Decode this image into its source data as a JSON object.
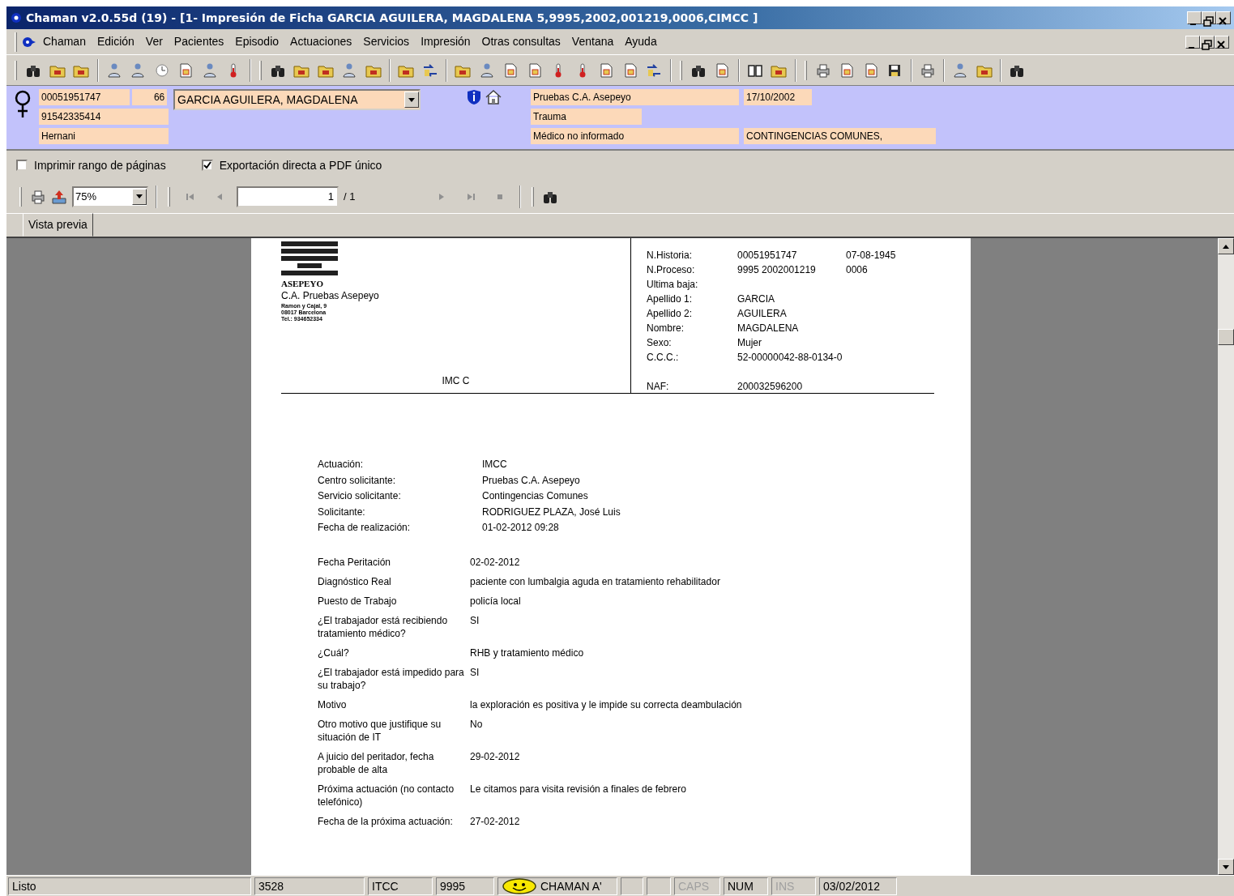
{
  "window": {
    "title": "Chaman v2.0.55d (19) - [1- Impresión de Ficha GARCIA AGUILERA, MAGDALENA 5,9995,2002,001219,0006,CIMCC  ]"
  },
  "menu": [
    "Chaman",
    "Edición",
    "Ver",
    "Pacientes",
    "Episodio",
    "Actuaciones",
    "Servicios",
    "Impresión",
    "Otras consultas",
    "Ventana",
    "Ayuda"
  ],
  "patient": {
    "history": "00051951747",
    "age": "66",
    "phone": "91542335414",
    "city": "Hernani",
    "name": "GARCIA AGUILERA, MAGDALENA",
    "center": "Pruebas C.A. Asepeyo",
    "date": "17/10/2002",
    "service": "Trauma",
    "doctor": "Médico no informado",
    "contingency": "CONTINGENCIAS COMUNES,"
  },
  "options": [
    {
      "label": "Imprimir rango de páginas",
      "checked": false
    },
    {
      "label": "Exportación directa a PDF único",
      "checked": true
    }
  ],
  "preview_toolbar": {
    "zoom": "75%",
    "page": "1",
    "page_total": "/ 1"
  },
  "tabs": [
    {
      "label": "Vista previa",
      "selected": true
    }
  ],
  "report": {
    "logo_text": "ASEPEYO",
    "center": "C.A. Pruebas Asepeyo",
    "address_lines": [
      "Ramon y Cajal, 9",
      "08017 Barcelona",
      "Tel.: 934652334"
    ],
    "code": "IMC C",
    "header_fields": [
      {
        "label": "N.Historia:",
        "value": "00051951747",
        "extra": "07-08-1945"
      },
      {
        "label": "N.Proceso:",
        "value": "9995 2002001219",
        "extra": "0006"
      },
      {
        "label": "Ultima baja:"
      },
      {
        "label": "Apellido 1:",
        "value": "GARCIA"
      },
      {
        "label": "Apellido 2:",
        "value": "AGUILERA"
      },
      {
        "label": "Nombre:",
        "value": "MAGDALENA"
      },
      {
        "label": "Sexo:",
        "value": "Mujer"
      },
      {
        "label": "C.C.C.:",
        "value": "52-00000042-88-0134-0"
      },
      {
        "label": "NAF:",
        "value": "200032596200"
      }
    ],
    "sections": [
      [
        {
          "label": "Actuación:",
          "value": "IMCC"
        },
        {
          "label": "Centro solicitante:",
          "value": "Pruebas C.A. Asepeyo"
        },
        {
          "label": "Servicio solicitante:",
          "value": "Contingencias Comunes"
        },
        {
          "label": "Solicitante:",
          "value": "RODRIGUEZ PLAZA, José Luis"
        },
        {
          "label": "Fecha de realización:",
          "value": "01-02-2012    09:28"
        }
      ],
      [
        {
          "label": "Fecha Peritación",
          "value": "02-02-2012"
        },
        {
          "label": "Diagnóstico Real",
          "value": "paciente con lumbalgia aguda en tratamiento rehabilitador"
        },
        {
          "label": "Puesto de Trabajo",
          "value": "policía local"
        },
        {
          "label": "¿El trabajador está recibiendo tratamiento médico?",
          "value": "SI"
        },
        {
          "label": "¿Cuál?",
          "value": "RHB y tratamiento médico"
        },
        {
          "label": "¿El trabajador está impedido para su trabajo?",
          "value": "SI"
        },
        {
          "label": "Motivo",
          "value": "la exploración es positiva y le impide su correcta deambulación"
        },
        {
          "label": "Otro motivo que justifique su situación de IT",
          "value": "No"
        },
        {
          "label": "A juicio del peritador, fecha probable de alta",
          "value": "29-02-2012"
        },
        {
          "label": "Próxima actuación (no contacto telefónico)",
          "value": "Le citamos para visita revisión a finales de febrero"
        },
        {
          "label": "Fecha de la próxima actuación:",
          "value": "27-02-2012"
        }
      ]
    ]
  },
  "status_bar": [
    {
      "kind": "text",
      "text": "Listo",
      "enabled": true
    },
    {
      "kind": "text",
      "text": "3528",
      "enabled": true
    },
    {
      "kind": "text",
      "text": "ITCC",
      "enabled": true
    },
    {
      "kind": "text",
      "text": "9995",
      "enabled": true
    },
    {
      "kind": "user",
      "text": "CHAMAN A'",
      "enabled": true
    },
    {
      "kind": "blank"
    },
    {
      "kind": "blank"
    },
    {
      "kind": "text",
      "text": "CAPS",
      "enabled": false
    },
    {
      "kind": "text",
      "text": "NUM",
      "enabled": true
    },
    {
      "kind": "text",
      "text": "INS",
      "enabled": false
    },
    {
      "kind": "text",
      "text": "03/02/2012",
      "enabled": true
    }
  ]
}
